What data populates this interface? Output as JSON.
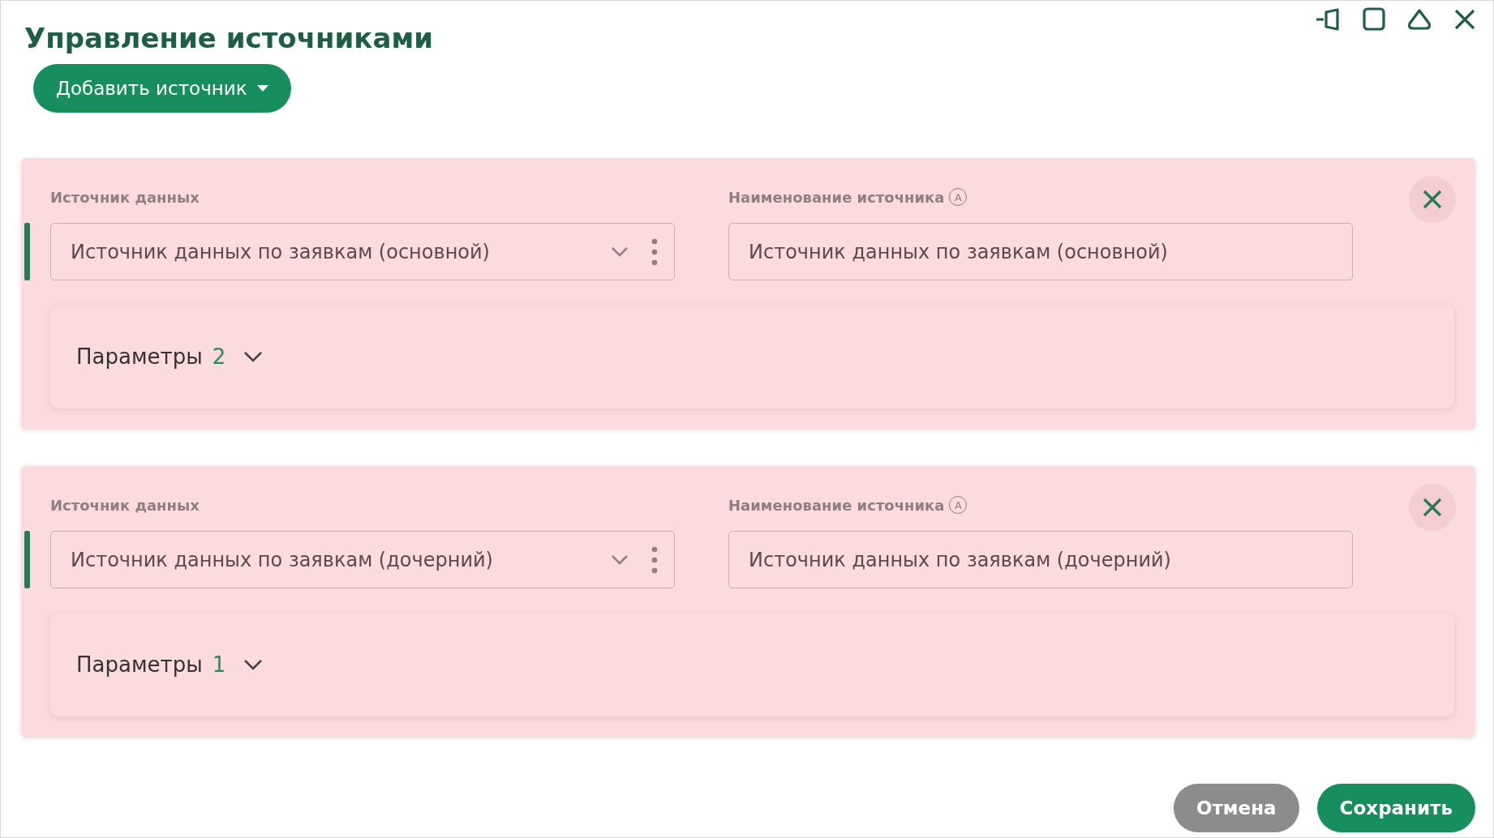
{
  "window": {
    "title": "Управление источниками"
  },
  "add_button": {
    "label": "Добавить источник"
  },
  "sources": [
    {
      "source_label": "Источник данных",
      "source_value": "Источник данных по заявкам (основной)",
      "name_label": "Наименование источника",
      "name_badge": "A",
      "name_value": "Источник данных по заявкам (основной)",
      "parameters": {
        "title": "Параметры",
        "count": "2",
        "expanded": false
      }
    },
    {
      "source_label": "Источник данных",
      "source_value": "Источник данных по заявкам (дочерний)",
      "name_label": "Наименование источника",
      "name_badge": "A",
      "name_value": "Источник данных по заявкам (дочерний)",
      "parameters": {
        "title": "Параметры",
        "count": "1",
        "expanded": false
      }
    }
  ],
  "buttons": [
    {
      "label": "Отмена",
      "kind": "secondary"
    },
    {
      "label": "Сохранить",
      "kind": "primary"
    }
  ]
}
